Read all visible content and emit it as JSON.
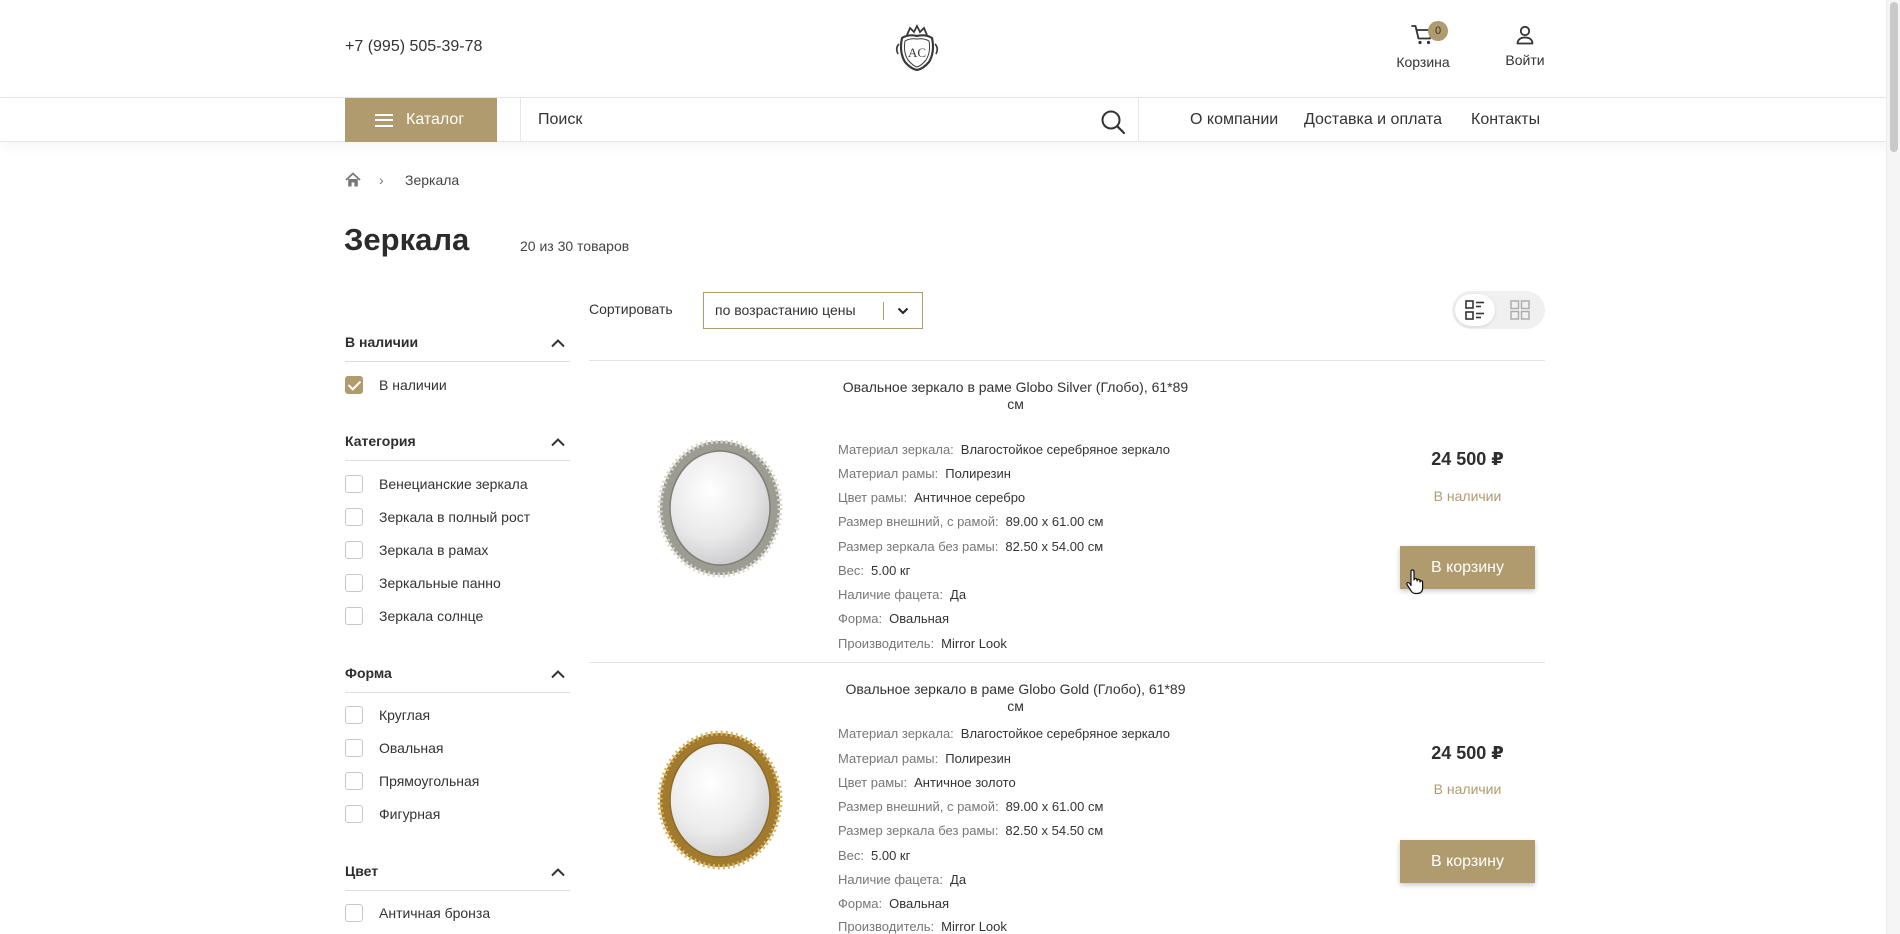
{
  "header": {
    "phone": "+7 (995) 505-39-78",
    "cart": {
      "label": "Корзина",
      "count": "0"
    },
    "login_label": "Войти"
  },
  "nav": {
    "catalog_label": "Каталог",
    "search_placeholder": "Поиск",
    "menu": [
      "О компании",
      "Доставка и оплата",
      "Контакты"
    ]
  },
  "breadcrumb": {
    "current": "Зеркала"
  },
  "page": {
    "title": "Зеркала",
    "count": "20 из 30 товаров"
  },
  "sort": {
    "label": "Сортировать",
    "value": "по возрастанию цены"
  },
  "filters": [
    {
      "title": "В наличии",
      "options": [
        {
          "label": "В наличии",
          "checked": true
        }
      ]
    },
    {
      "title": "Категория",
      "options": [
        {
          "label": "Венецианские зеркала",
          "checked": false
        },
        {
          "label": "Зеркала в полный рост",
          "checked": false
        },
        {
          "label": "Зеркала в рамах",
          "checked": false
        },
        {
          "label": "Зеркальные панно",
          "checked": false
        },
        {
          "label": "Зеркала солнце",
          "checked": false
        }
      ]
    },
    {
      "title": "Форма",
      "options": [
        {
          "label": "Круглая",
          "checked": false
        },
        {
          "label": "Овальная",
          "checked": false
        },
        {
          "label": "Прямоугольная",
          "checked": false
        },
        {
          "label": "Фигурная",
          "checked": false
        }
      ]
    },
    {
      "title": "Цвет",
      "options": [
        {
          "label": "Античная бронза",
          "checked": false
        }
      ]
    }
  ],
  "products": [
    {
      "title_line1": "Овальное зеркало в раме Globo Silver (Глобо), 61*89",
      "title_line2": "см",
      "frame_color": "silver",
      "specs": [
        {
          "key": "Материал зеркала:",
          "value": "Влагостойкое серебряное зеркало"
        },
        {
          "key": "Материал рамы:",
          "value": "Полирезин"
        },
        {
          "key": "Цвет рамы:",
          "value": "Античное серебро"
        },
        {
          "key": "Размер внешний, с рамой:",
          "value": "89.00 х 61.00 см"
        },
        {
          "key": "Размер зеркала без рамы:",
          "value": "82.50 х 54.00 см"
        },
        {
          "key": "Вес:",
          "value": "5.00 кг"
        },
        {
          "key": "Наличие фацета:",
          "value": "Да"
        },
        {
          "key": "Форма:",
          "value": "Овальная"
        },
        {
          "key": "Производитель:",
          "value": "Mirror Look"
        }
      ],
      "price": "24 500 ₽",
      "availability": "В наличии",
      "buy_label": "В корзину"
    },
    {
      "title_line1": "Овальное зеркало в раме Globo Gold (Глобо), 61*89 см",
      "title_line2": "",
      "frame_color": "gold",
      "specs": [
        {
          "key": "Материал зеркала:",
          "value": "Влагостойкое серебряное зеркало"
        },
        {
          "key": "Материал рамы:",
          "value": "Полирезин"
        },
        {
          "key": "Цвет рамы:",
          "value": "Античное золото"
        },
        {
          "key": "Размер внешний, с рамой:",
          "value": "89.00 х 61.00 см"
        },
        {
          "key": "Размер зеркала без рамы:",
          "value": "82.50 х 54.50 см"
        },
        {
          "key": "Вес:",
          "value": "5.00 кг"
        },
        {
          "key": "Наличие фацета:",
          "value": "Да"
        },
        {
          "key": "Форма:",
          "value": "Овальная"
        },
        {
          "key": "Производитель:",
          "value": "Mirror Look"
        }
      ],
      "price": "24 500 ₽",
      "availability": "В наличии",
      "buy_label": "В корзину"
    }
  ],
  "colors": {
    "accent": "#b09b6f",
    "text": "#333333",
    "divider": "#e3e3e3"
  },
  "icons": [
    "logo-monogram",
    "cart-icon",
    "user-icon",
    "search-icon",
    "home-icon",
    "chevron-up-icon",
    "chevron-down-icon",
    "list-view-icon",
    "grid-view-icon",
    "hand-pointer-icon"
  ]
}
